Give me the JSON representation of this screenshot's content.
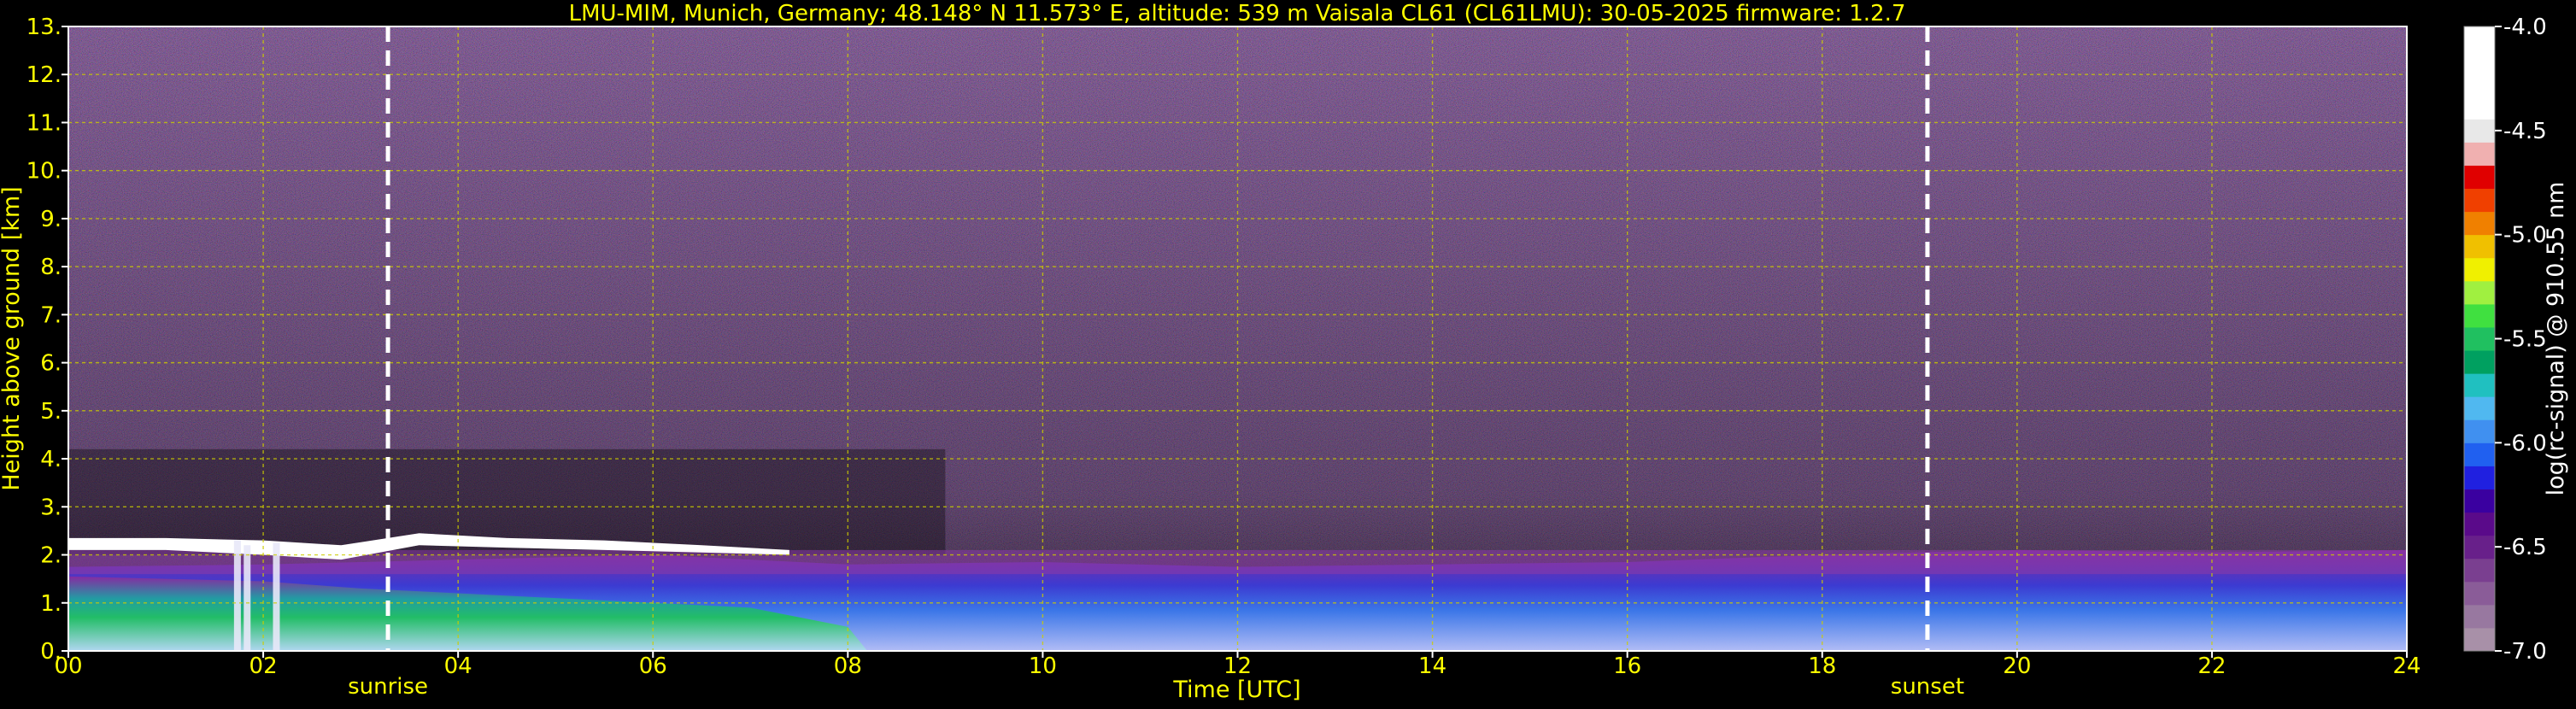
{
  "chart_data": {
    "type": "heatmap",
    "title": "LMU-MIM, Munich, Germany; 48.148° N 11.573° E, altitude: 539 m    Vaisala CL61 (CL61LMU): 30-05-2025    firmware: 1.2.7",
    "xlabel": "Time [UTC]",
    "ylabel": "Height above ground [km]",
    "xlim": [
      0,
      24
    ],
    "ylim": [
      0,
      13
    ],
    "x_ticks": [
      "00",
      "02",
      "04",
      "06",
      "08",
      "10",
      "12",
      "14",
      "16",
      "18",
      "20",
      "22",
      "24"
    ],
    "y_ticks": [
      "0.",
      "1.",
      "2.",
      "3.",
      "4.",
      "5.",
      "6.",
      "7.",
      "8.",
      "9.",
      "10.",
      "11.",
      "12.",
      "13."
    ],
    "grid": true,
    "markers": [
      {
        "label": "sunrise",
        "time": 3.28
      },
      {
        "label": "sunset",
        "time": 19.08
      }
    ],
    "colorbar": {
      "label": "log(rc-signal) @ 910.55 nm",
      "range": [
        -7.0,
        -4.0
      ],
      "ticks": [
        "-4.0",
        "-4.5",
        "-5.0",
        "-5.5",
        "-6.0",
        "-6.5",
        "-7.0"
      ],
      "colors": [
        "#a890a8",
        "#9878a0",
        "#8a5c98",
        "#7a3f90",
        "#68208a",
        "#5a0a8a",
        "#3a00a0",
        "#2020e0",
        "#2060f0",
        "#4090f0",
        "#50b8f0",
        "#20c0c0",
        "#00a060",
        "#20c060",
        "#40e040",
        "#a0f040",
        "#f0f000",
        "#f0c000",
        "#f08000",
        "#f04000",
        "#e00000",
        "#f0b0b0",
        "#e8e8e8",
        "#ffffff",
        "#ffffff",
        "#ffffff",
        "#ffffff"
      ]
    },
    "features": [
      {
        "name": "elevated aerosol/cloud layer",
        "time_range": [
          0,
          7.4
        ],
        "height_km": 2.2
      },
      {
        "name": "boundary layer aerosol",
        "time_range": [
          0,
          24
        ],
        "height_range_km": [
          0,
          2.0
        ]
      }
    ]
  }
}
